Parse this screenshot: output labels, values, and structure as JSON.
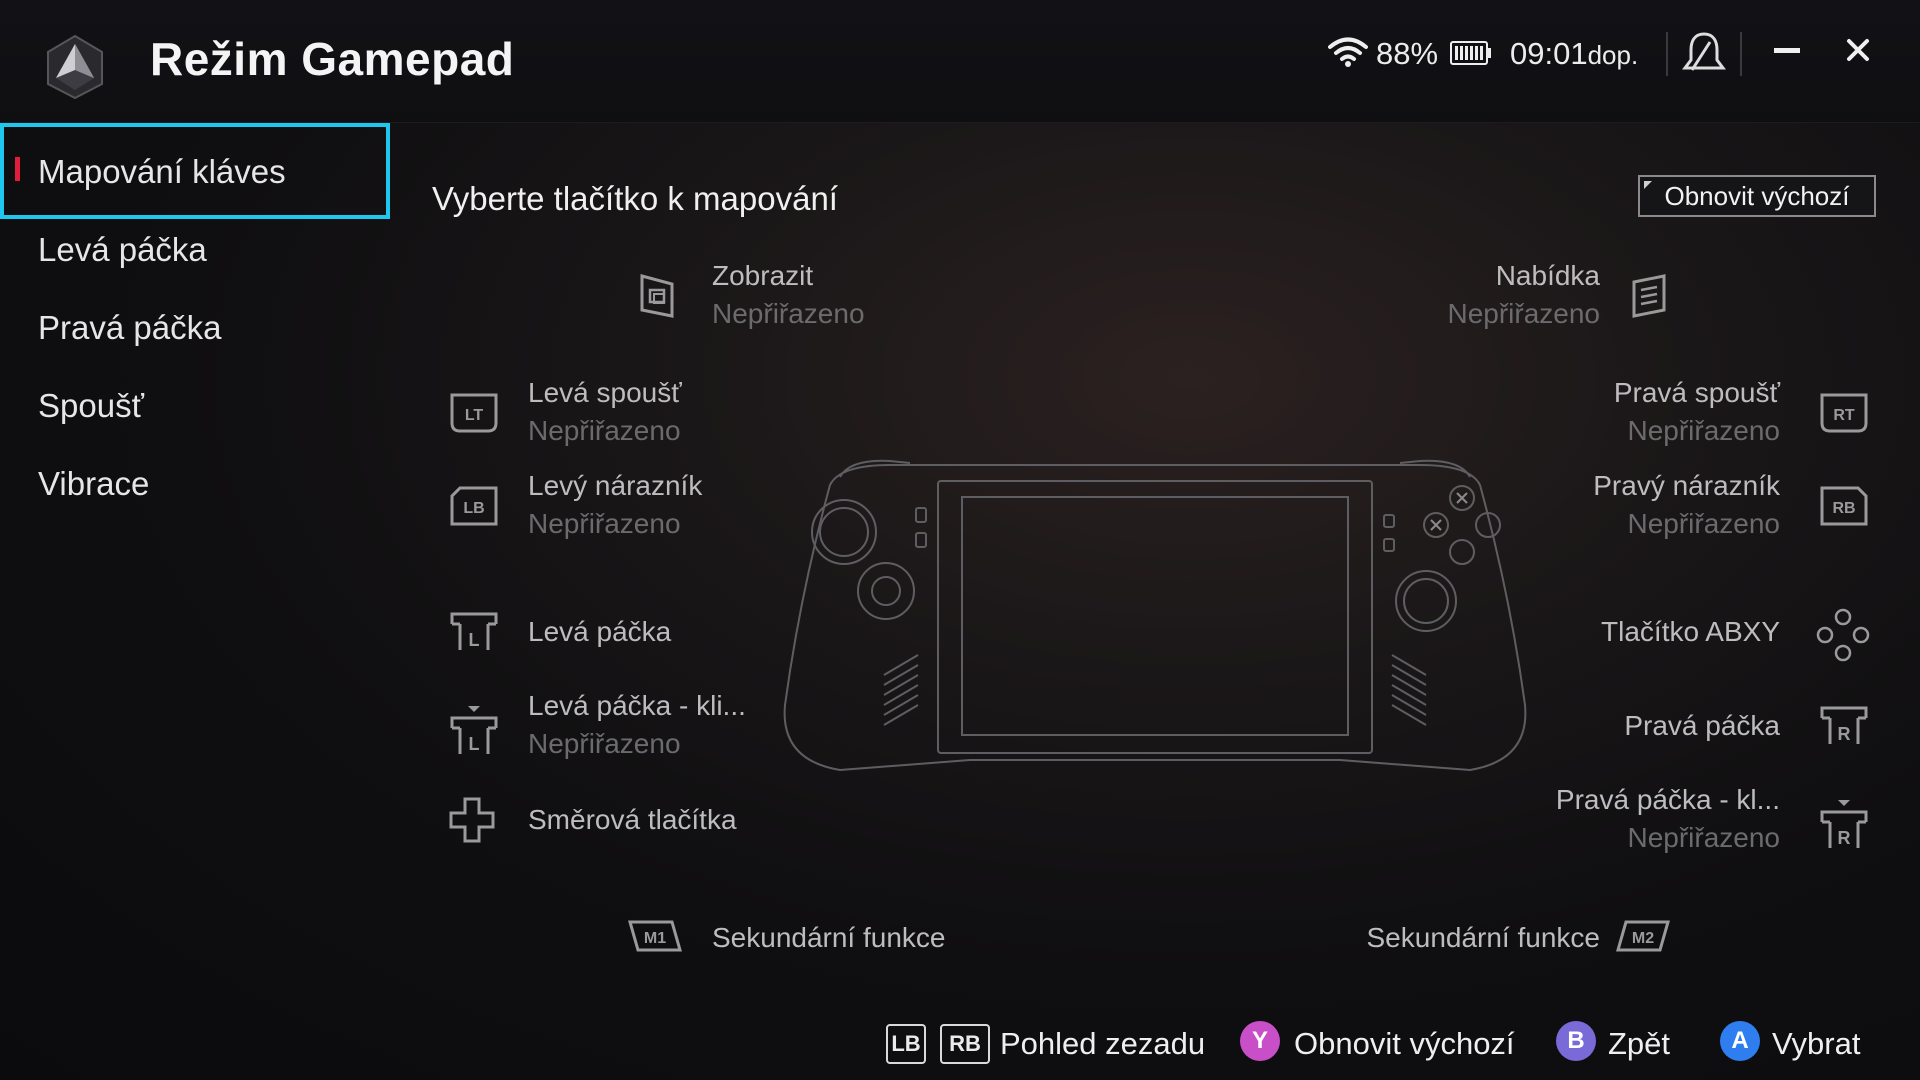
{
  "app": {
    "title": "Režim Gamepad"
  },
  "status": {
    "battery_percent": "88%",
    "time": "09:01",
    "time_suffix": "dop."
  },
  "sidebar": {
    "items": [
      {
        "label": "Mapování kláves",
        "active": true
      },
      {
        "label": "Levá páčka"
      },
      {
        "label": "Pravá páčka"
      },
      {
        "label": "Spoušť"
      },
      {
        "label": "Vibrace"
      }
    ]
  },
  "main": {
    "title": "Vyberte tlačítko k mapování",
    "reset_label": "Obnovit výchozí",
    "left_items": {
      "view": {
        "label": "Zobrazit",
        "value": "Nepřiřazeno"
      },
      "lt": {
        "label": "Levá spoušť",
        "value": "Nepřiřazeno"
      },
      "lb": {
        "label": "Levý nárazník",
        "value": "Nepřiřazeno"
      },
      "lstick": {
        "label": "Levá páčka"
      },
      "lstick_click": {
        "label": "Levá páčka - kli...",
        "value": "Nepřiřazeno"
      },
      "dpad": {
        "label": "Směrová tlačítka"
      },
      "m1": {
        "label": "Sekundární funkce"
      }
    },
    "right_items": {
      "menu": {
        "label": "Nabídka",
        "value": "Nepřiřazeno"
      },
      "rt": {
        "label": "Pravá spoušť",
        "value": "Nepřiřazeno"
      },
      "rb": {
        "label": "Pravý nárazník",
        "value": "Nepřiřazeno"
      },
      "abxy": {
        "label": "Tlačítko ABXY"
      },
      "rstick": {
        "label": "Pravá páčka"
      },
      "rstick_click": {
        "label": "Pravá páčka - kl...",
        "value": "Nepřiřazeno"
      },
      "m2": {
        "label": "Sekundární funkce"
      }
    },
    "icon_texts": {
      "lt": "LT",
      "lb": "LB",
      "rt": "RT",
      "rb": "RB",
      "m1": "M1",
      "m2": "M2",
      "l": "L",
      "r": "R"
    }
  },
  "footer": {
    "lb": "LB",
    "rb": "RB",
    "rear_view": "Pohled zezadu",
    "y": "Y",
    "reset": "Obnovit výchozí",
    "b": "B",
    "back": "Zpět",
    "a": "A",
    "select": "Vybrat",
    "colors": {
      "y": "#c94fc9",
      "b": "#7a6ad8",
      "a": "#2f7ef0"
    }
  },
  "colors": {
    "accent": "#1fc7ef",
    "marker": "#e01d3b"
  }
}
